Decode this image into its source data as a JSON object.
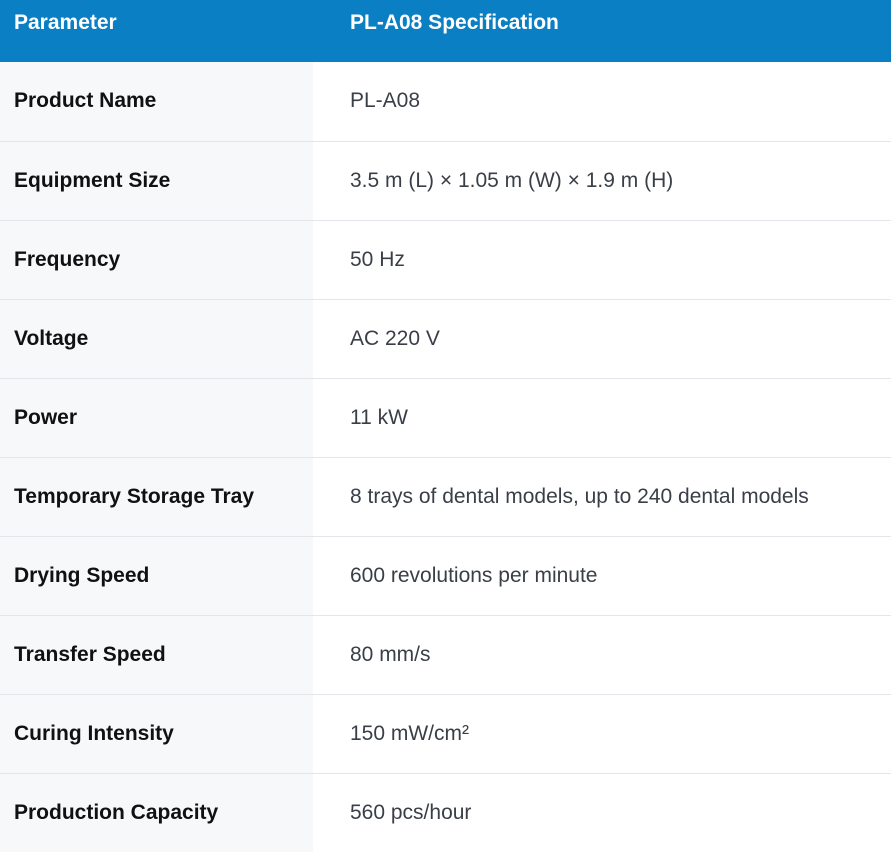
{
  "table": {
    "headers": {
      "parameter": "Parameter",
      "specification": "PL-A08 Specification"
    },
    "rows": [
      {
        "parameter": "Product Name",
        "value": "PL-A08"
      },
      {
        "parameter": "Equipment Size",
        "value": "3.5 m (L) × 1.05 m (W) × 1.9 m (H)"
      },
      {
        "parameter": "Frequency",
        "value": "50 Hz"
      },
      {
        "parameter": "Voltage",
        "value": "AC 220 V"
      },
      {
        "parameter": "Power",
        "value": "11 kW"
      },
      {
        "parameter": "Temporary Storage Tray",
        "value": "8 trays of dental models, up to 240 dental models"
      },
      {
        "parameter": "Drying Speed",
        "value": "600 revolutions per minute"
      },
      {
        "parameter": "Transfer Speed",
        "value": "80 mm/s"
      },
      {
        "parameter": "Curing Intensity",
        "value": "150 mW/cm²"
      },
      {
        "parameter": "Production Capacity",
        "value": "560 pcs/hour"
      }
    ]
  },
  "colors": {
    "header_background": "#0b7fc3",
    "header_text": "#ffffff",
    "param_column_background": "#f7f8fa",
    "row_divider": "#e3e6ea"
  }
}
